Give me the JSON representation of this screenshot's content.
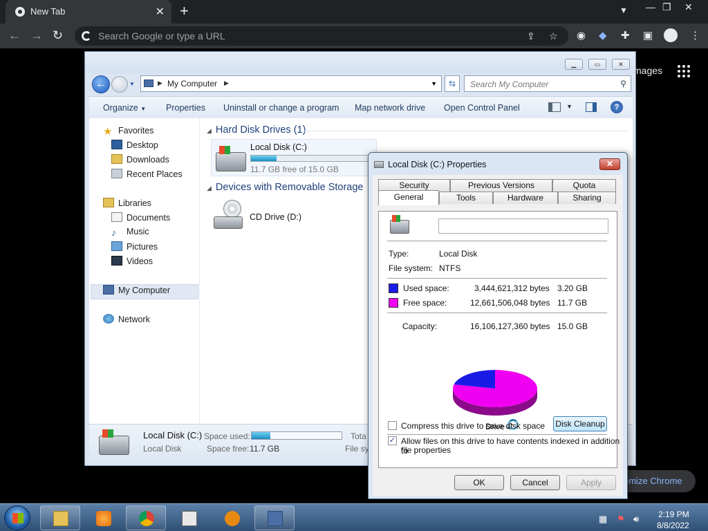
{
  "chrome": {
    "tab_title": "New Tab",
    "omnibox_placeholder": "Search Google or type a URL",
    "images_link": "mages",
    "customize_label": "omize Chrome"
  },
  "explorer": {
    "address": "My Computer",
    "search_placeholder": "Search My Computer",
    "commands": [
      "Organize",
      "Properties",
      "Uninstall or change a program",
      "Map network drive",
      "Open Control Panel"
    ],
    "nav": {
      "favorites": "Favorites",
      "desktop": "Desktop",
      "downloads": "Downloads",
      "recent_places": "Recent Places",
      "libraries": "Libraries",
      "documents": "Documents",
      "music": "Music",
      "pictures": "Pictures",
      "videos": "Videos",
      "my_computer": "My Computer",
      "network": "Network"
    },
    "groups": {
      "hdd": "Hard Disk Drives (1)",
      "removable": "Devices with Removable Storage"
    },
    "drive_c": {
      "name": "Local Disk (C:)",
      "free_text": "11.7 GB free of 15.0 GB",
      "used_fraction": 0.21
    },
    "cd_drive": "CD Drive (D:)",
    "details": {
      "name": "Local Disk (C:)",
      "type": "Local Disk",
      "space_used_label": "Space used:",
      "space_free_label": "Space free:",
      "space_free_value": "11.7 GB",
      "total_label": "Tota",
      "fs_label": "File sy"
    }
  },
  "properties": {
    "title": "Local Disk (C:) Properties",
    "tabs_top": [
      "Security",
      "Previous Versions",
      "Quota"
    ],
    "tabs_bottom": [
      "General",
      "Tools",
      "Hardware",
      "Sharing"
    ],
    "type_label": "Type:",
    "type_value": "Local Disk",
    "fs_label": "File system:",
    "fs_value": "NTFS",
    "used_label": "Used space:",
    "used_bytes": "3,444,621,312 bytes",
    "used_gb": "3.20 GB",
    "free_label": "Free space:",
    "free_bytes": "12,661,506,048 bytes",
    "free_gb": "11.7 GB",
    "capacity_label": "Capacity:",
    "capacity_bytes": "16,106,127,360 bytes",
    "capacity_gb": "15.0 GB",
    "drive_label": "Drive C",
    "cleanup_button": "Disk Cleanup",
    "compress_label": "Compress this drive to save disk space",
    "compress_checked": false,
    "index_label_1": "Allow files on this drive to have contents indexed in addition to",
    "index_label_2": "file properties",
    "index_checked": true,
    "ok": "OK",
    "cancel": "Cancel",
    "apply": "Apply",
    "colors": {
      "used": "#1a1ae6",
      "free": "#f000f0"
    },
    "pie": {
      "used_fraction": 0.214,
      "free_fraction": 0.786
    }
  },
  "taskbar": {
    "time": "2:19 PM",
    "date": "8/8/2022"
  }
}
